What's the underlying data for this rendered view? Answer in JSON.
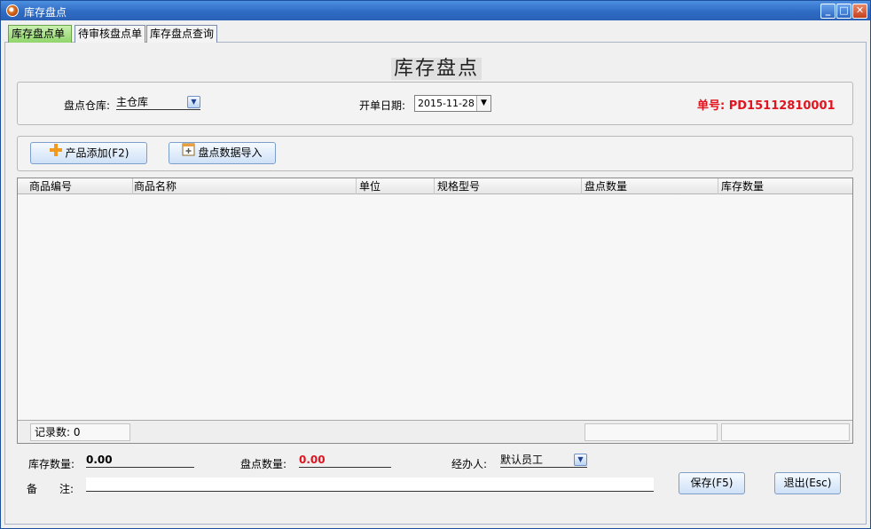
{
  "window": {
    "title": "库存盘点",
    "buttons": {
      "minimize": "_",
      "maximize": "□",
      "close": "✕"
    }
  },
  "tabs": [
    {
      "label": "库存盘点单",
      "active": true
    },
    {
      "label": "待审核盘点单",
      "active": false
    },
    {
      "label": "库存盘点查询",
      "active": false
    }
  ],
  "page_title": "库存盘点",
  "header": {
    "warehouse_label": "盘点仓库:",
    "warehouse_value": "主仓库",
    "date_label": "开单日期:",
    "date_value": "2015-11-28",
    "order_no_label": "单号:",
    "order_no_value": "PD15112810001"
  },
  "toolbar": {
    "add_product_label": "产品添加(F2)",
    "import_label": "盘点数据导入"
  },
  "grid": {
    "columns": [
      "商品编号",
      "商品名称",
      "单位",
      "规格型号",
      "盘点数量",
      "库存数量"
    ],
    "rows": [],
    "footer": {
      "record_count_label": "记录数:",
      "record_count_value": "0"
    }
  },
  "summary": {
    "stock_qty_label": "库存数量:",
    "stock_qty_value": "0.00",
    "count_qty_label": "盘点数量:",
    "count_qty_value": "0.00",
    "handler_label": "经办人:",
    "handler_value": "默认员工",
    "remark_label_1": "备",
    "remark_label_2": "注:",
    "remark_value": ""
  },
  "actions": {
    "save_label": "保存(F5)",
    "exit_label": "退出(Esc)"
  },
  "colors": {
    "accent": "#2f6cc4",
    "order_no": "#e0141e",
    "active_tab": "#8fd46a"
  },
  "icons": {
    "add": "plus-icon",
    "import": "import-icon",
    "dropdown": "chevron-down-icon"
  }
}
